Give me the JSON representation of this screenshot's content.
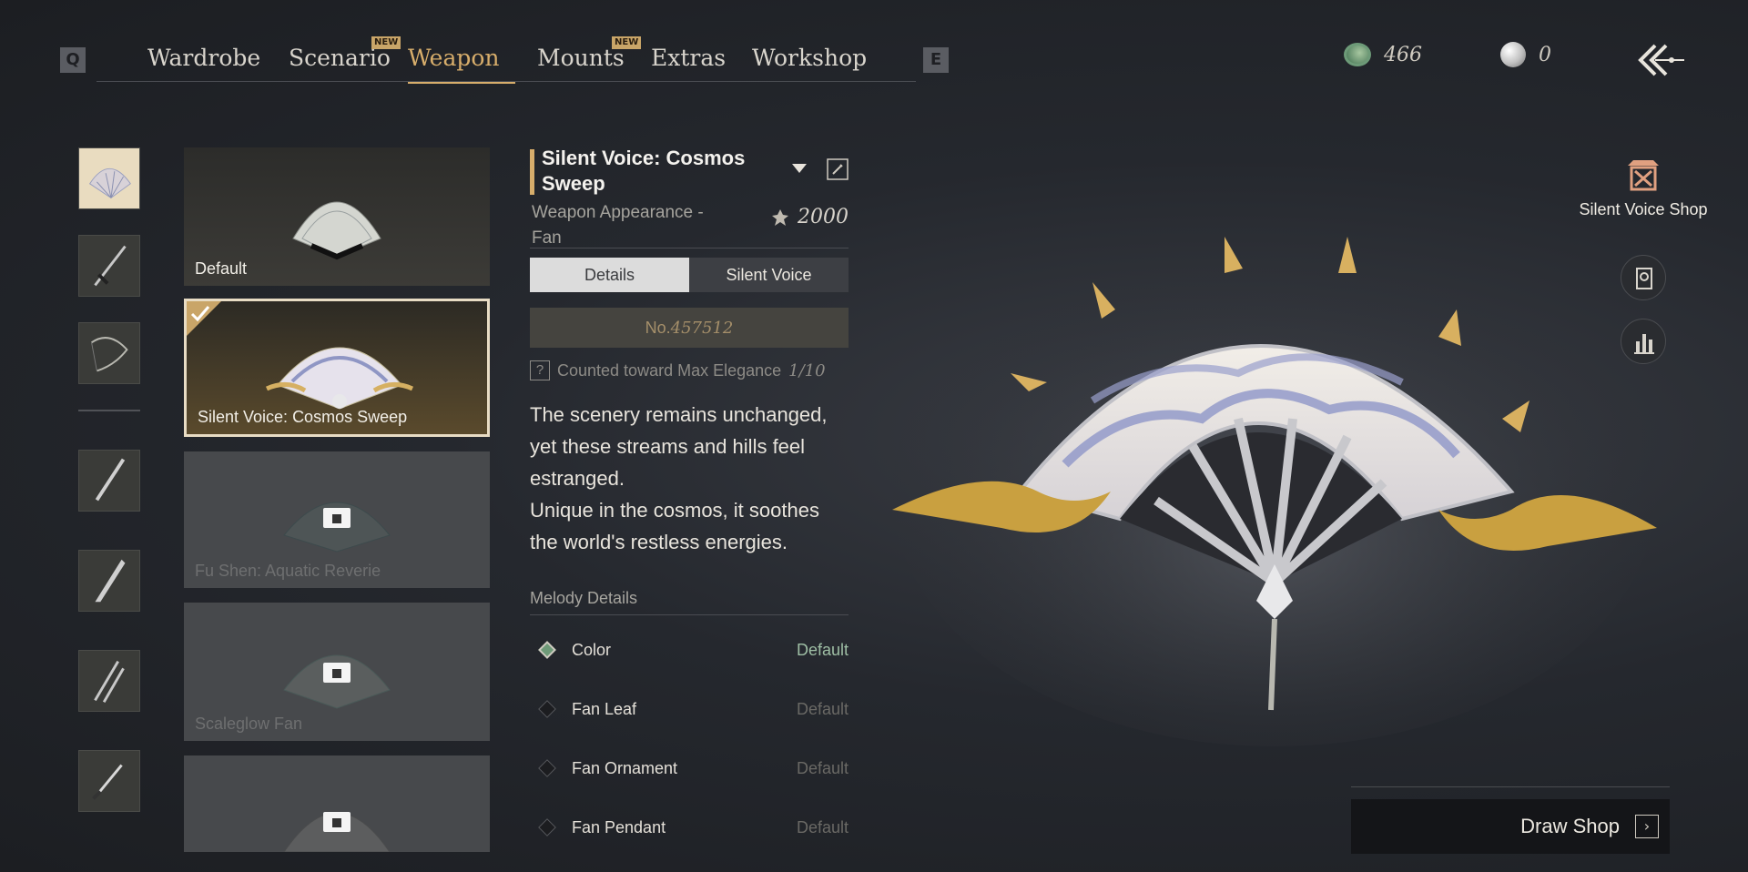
{
  "nav": {
    "left_key": "Q",
    "right_key": "E",
    "tabs": [
      {
        "label": "Wardrobe",
        "new": false
      },
      {
        "label": "Scenario",
        "new": true
      },
      {
        "label": "Weapon",
        "new": false,
        "active": true
      },
      {
        "label": "Mounts",
        "new": true
      },
      {
        "label": "Extras",
        "new": false
      },
      {
        "label": "Workshop",
        "new": false
      }
    ],
    "new_badge": "NEW"
  },
  "currency": {
    "jade": "466",
    "pearl": "0"
  },
  "categories": [
    {
      "icon": "fan-thumbnail-icon",
      "selected": true
    },
    {
      "icon": "sword-icon"
    },
    {
      "icon": "bow-icon"
    },
    {
      "icon": "spear-icon"
    },
    {
      "icon": "blade-icon"
    },
    {
      "icon": "dual-blades-icon"
    },
    {
      "icon": "dagger-icon"
    }
  ],
  "cards": [
    {
      "label": "Default",
      "state": "owned"
    },
    {
      "label": "Silent Voice: Cosmos Sweep",
      "state": "selected"
    },
    {
      "label": "Fu Shen: Aquatic Reverie",
      "state": "locked"
    },
    {
      "label": "Scaleglow Fan",
      "state": "locked"
    },
    {
      "label": "",
      "state": "locked"
    }
  ],
  "detail": {
    "title": "Silent Voice: Cosmos Sweep",
    "subtitle": "Weapon Appearance - Fan",
    "price": "2000",
    "tabs": [
      "Details",
      "Silent Voice"
    ],
    "serial_prefix": "No.",
    "serial_number": "457512",
    "elegance_label": "Counted toward Max Elegance",
    "elegance_value": "1/10",
    "description": [
      "The scenery remains unchanged, yet these streams and hills feel estranged.",
      "Unique in the cosmos, it soothes the world's restless energies."
    ],
    "melody_header": "Melody Details",
    "melody": [
      {
        "name": "Color",
        "value": "Default",
        "active": true
      },
      {
        "name": "Fan Leaf",
        "value": "Default",
        "active": false
      },
      {
        "name": "Fan Ornament",
        "value": "Default",
        "active": false
      },
      {
        "name": "Fan Pendant",
        "value": "Default",
        "active": false
      }
    ]
  },
  "right": {
    "shop_label": "Silent Voice Shop",
    "draw_shop_label": "Draw Shop"
  },
  "colors": {
    "accent": "#d7ad6b",
    "jade": "#6e9a78"
  }
}
